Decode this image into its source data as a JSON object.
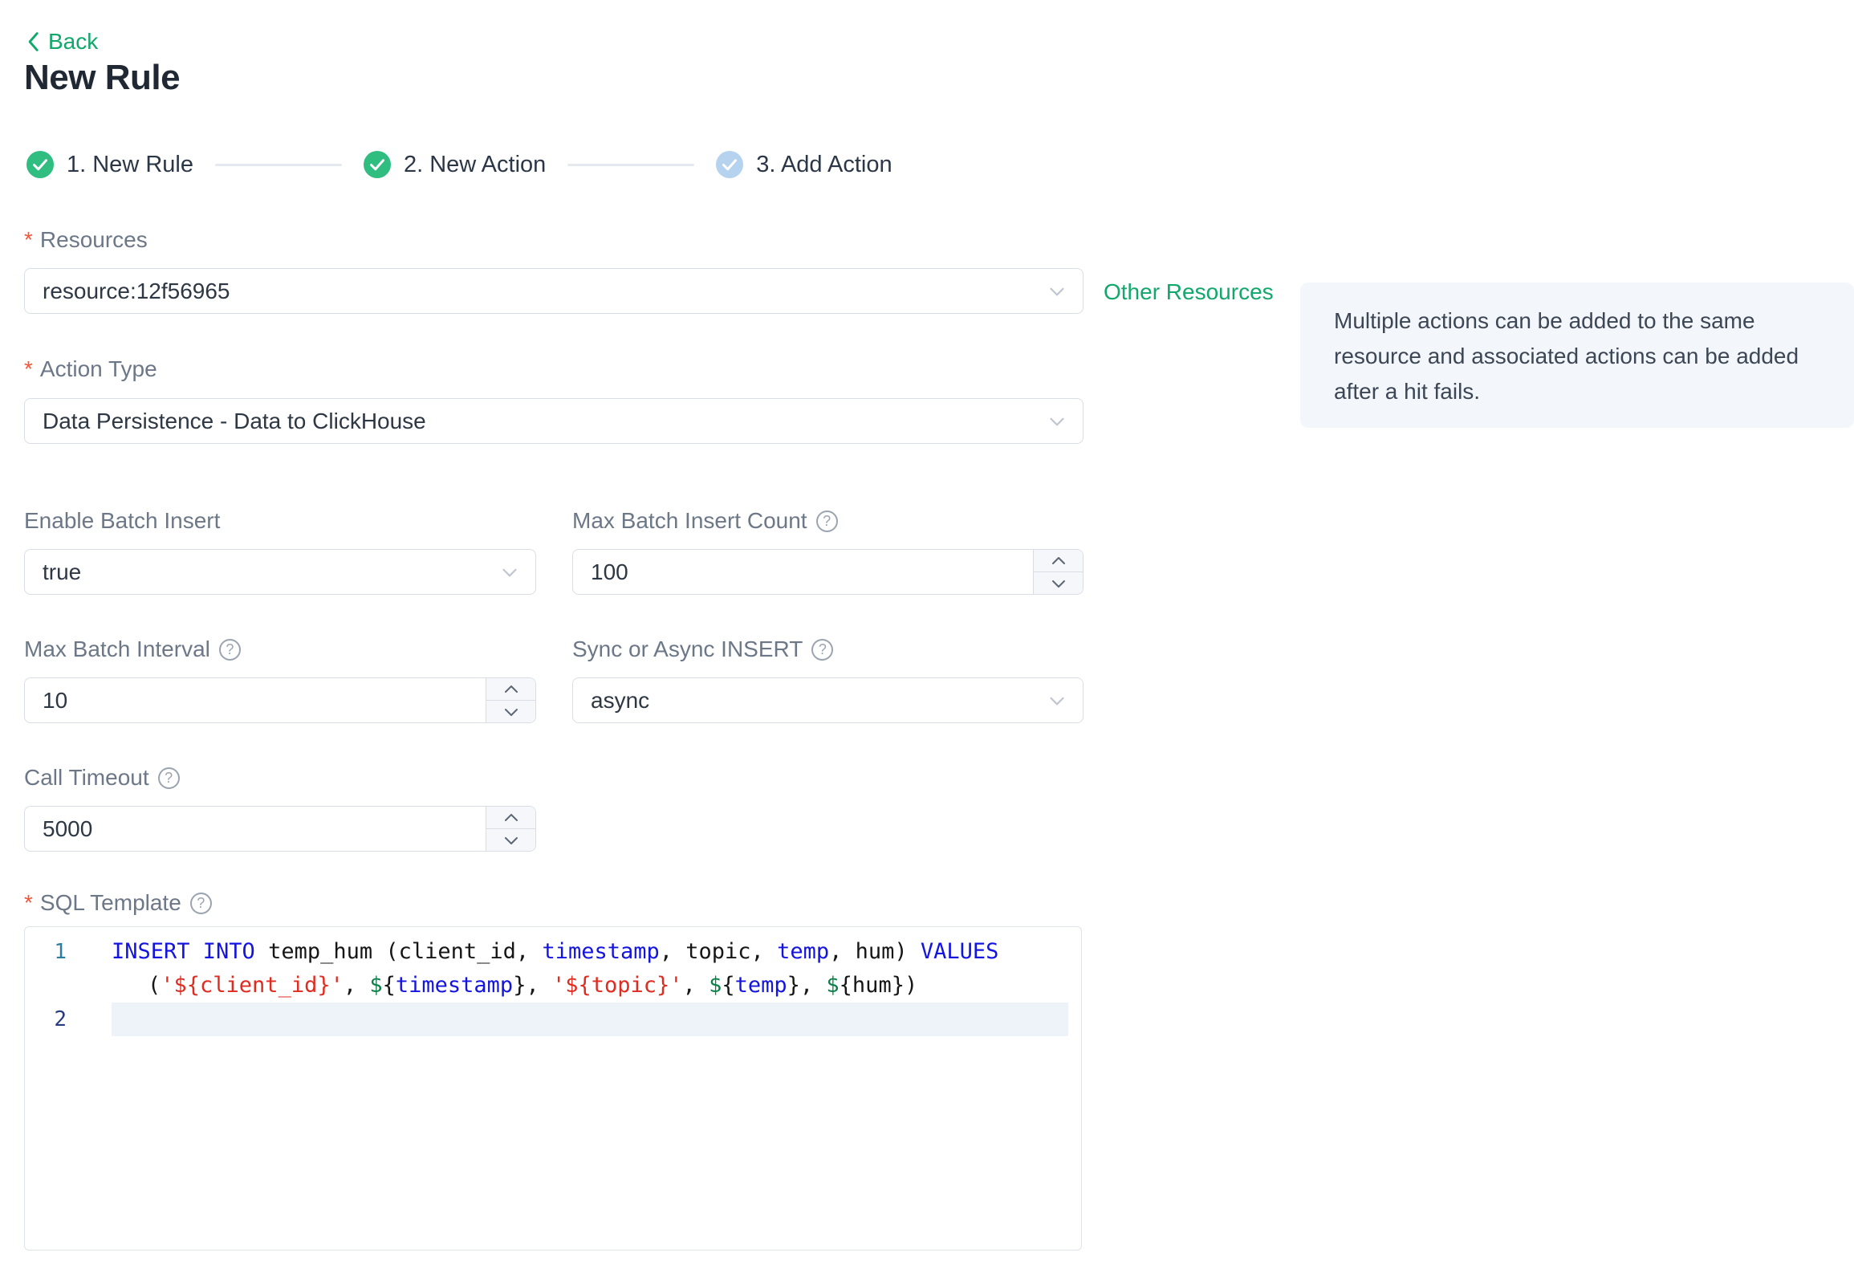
{
  "header": {
    "back": "Back",
    "title": "New Rule"
  },
  "marks": {
    "required": "*",
    "help": "?"
  },
  "steps": [
    {
      "label": "1. New Rule",
      "state": "done"
    },
    {
      "label": "2. New Action",
      "state": "done"
    },
    {
      "label": "3. Add Action",
      "state": "pending"
    }
  ],
  "fields": {
    "resources": {
      "label": "Resources",
      "value": "resource:12f56965"
    },
    "other_resources_link": "Other Resources",
    "info_tip": "Multiple actions can be added to the same resource and associated actions can be added after a hit fails.",
    "action_type": {
      "label": "Action Type",
      "value": "Data Persistence - Data to ClickHouse"
    },
    "enable_batch_insert": {
      "label": "Enable Batch Insert",
      "value": "true"
    },
    "max_batch_insert_count": {
      "label": "Max Batch Insert Count",
      "value": "100"
    },
    "max_batch_interval": {
      "label": "Max Batch Interval",
      "value": "10"
    },
    "sync_or_async_insert": {
      "label": "Sync or Async INSERT",
      "value": "async"
    },
    "call_timeout": {
      "label": "Call Timeout",
      "value": "5000"
    },
    "sql_template": {
      "label": "SQL Template"
    }
  },
  "editor": {
    "rows": [
      {
        "num": "1",
        "num_color": "teal",
        "active": false,
        "indent": false,
        "tokens": [
          {
            "c": "kw",
            "t": "INSERT INTO"
          },
          {
            "c": "plain",
            "t": " temp_hum (client_id, "
          },
          {
            "c": "kw",
            "t": "timestamp"
          },
          {
            "c": "plain",
            "t": ", topic, "
          },
          {
            "c": "kw",
            "t": "temp"
          },
          {
            "c": "plain",
            "t": ", hum) "
          },
          {
            "c": "kw",
            "t": "VALUES"
          }
        ]
      },
      {
        "num": "",
        "num_color": "",
        "active": false,
        "indent": true,
        "tokens": [
          {
            "c": "plain",
            "t": "("
          },
          {
            "c": "str",
            "t": "'${client_id}'"
          },
          {
            "c": "plain",
            "t": ", "
          },
          {
            "c": "grn",
            "t": "$"
          },
          {
            "c": "plain",
            "t": "{"
          },
          {
            "c": "kw",
            "t": "timestamp"
          },
          {
            "c": "plain",
            "t": "}, "
          },
          {
            "c": "str",
            "t": "'${topic}'"
          },
          {
            "c": "plain",
            "t": ", "
          },
          {
            "c": "grn",
            "t": "$"
          },
          {
            "c": "plain",
            "t": "{"
          },
          {
            "c": "kw",
            "t": "temp"
          },
          {
            "c": "plain",
            "t": "}, "
          },
          {
            "c": "grn",
            "t": "$"
          },
          {
            "c": "plain",
            "t": "{hum})"
          }
        ]
      },
      {
        "num": "2",
        "num_color": "navy",
        "active": true,
        "indent": false,
        "tokens": []
      }
    ]
  },
  "colors": {
    "accent_green": "#12a76b",
    "step_done_green": "#2fbd80",
    "step_pending_blue": "#b5d3ef",
    "required_red": "#f0583b",
    "info_box_bg": "#f3f7fb",
    "code_keyword_blue": "#1414e0",
    "code_string_red": "#e02b20",
    "code_dollar_green": "#0a8048",
    "active_line_bg": "#edf3f9"
  }
}
